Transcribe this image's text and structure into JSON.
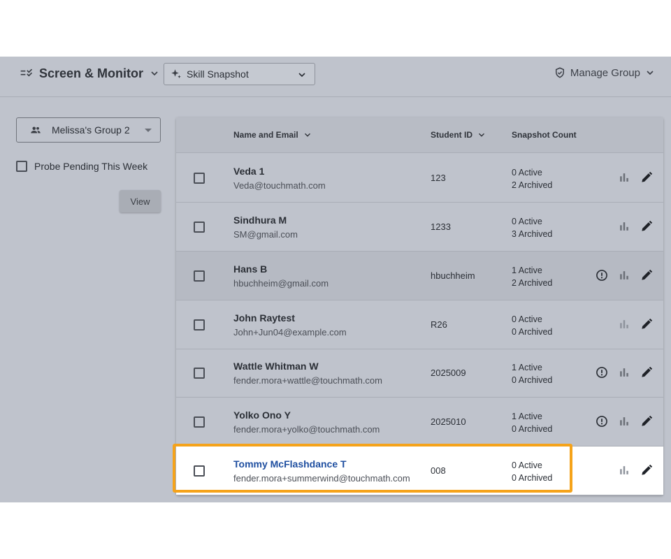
{
  "header": {
    "app_title": "Screen & Monitor",
    "snapshot_select": "Skill Snapshot",
    "manage_group": "Manage Group"
  },
  "sidebar": {
    "group_select": "Melissa's Group 2",
    "probe_label": "Probe Pending This Week",
    "view_button": "View"
  },
  "table": {
    "columns": {
      "name": "Name and Email",
      "student_id": "Student ID",
      "snapshot_count": "Snapshot Count"
    },
    "rows": [
      {
        "name": "Veda 1",
        "email": "Veda@touchmath.com",
        "student_id": "123",
        "active": "0 Active",
        "archived": "2 Archived",
        "alert": false
      },
      {
        "name": "Sindhura M",
        "email": "SM@gmail.com",
        "student_id": "1233",
        "active": "0 Active",
        "archived": "3 Archived",
        "alert": false
      },
      {
        "name": "Hans B",
        "email": "hbuchheim@gmail.com",
        "student_id": "hbuchheim",
        "active": "1 Active",
        "archived": "2 Archived",
        "alert": true
      },
      {
        "name": "John Raytest",
        "email": "John+Jun04@example.com",
        "student_id": "R26",
        "active": "0 Active",
        "archived": "0 Archived",
        "alert": false
      },
      {
        "name": "Wattle Whitman W",
        "email": "fender.mora+wattle@touchmath.com",
        "student_id": "2025009",
        "active": "1 Active",
        "archived": "0 Archived",
        "alert": true
      },
      {
        "name": "Yolko Ono Y",
        "email": "fender.mora+yolko@touchmath.com",
        "student_id": "2025010",
        "active": "1 Active",
        "archived": "0 Archived",
        "alert": true
      },
      {
        "name": "Tommy McFlashdance T",
        "email": "fender.mora+summerwind@touchmath.com",
        "student_id": "008",
        "active": "0 Active",
        "archived": "0 Archived",
        "alert": false
      }
    ]
  },
  "colors": {
    "highlight_border": "#f5a31a",
    "highlight_name": "#1f4fa0",
    "app_background": "#bfc3cc"
  }
}
